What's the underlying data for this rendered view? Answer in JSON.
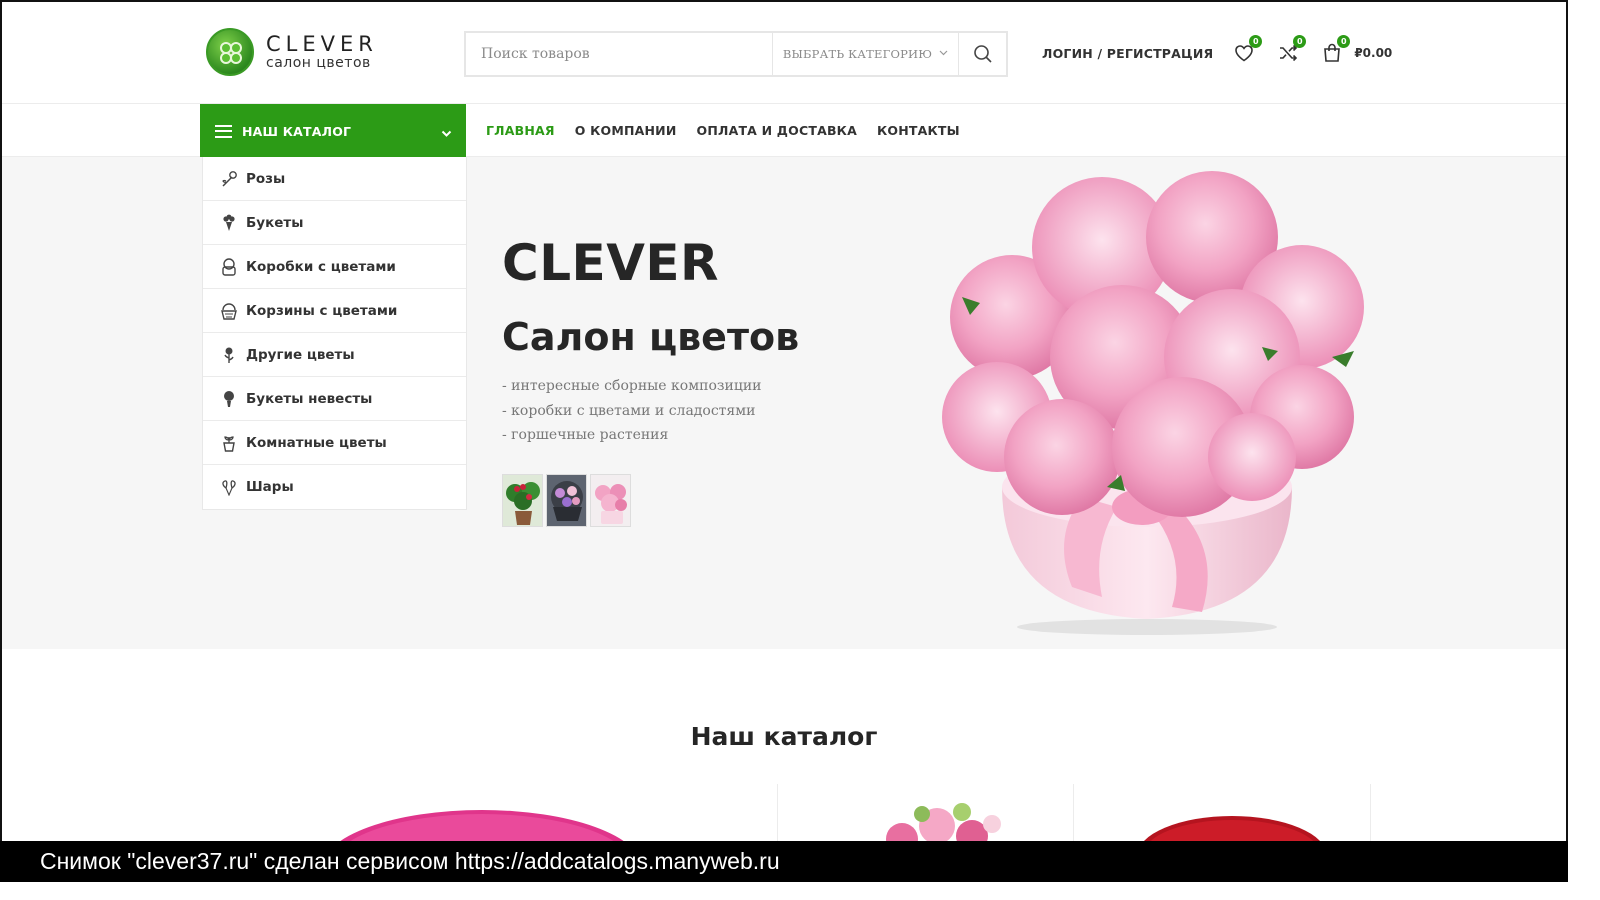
{
  "brand": {
    "title": "CLEVER",
    "subtitle": "салон цветов"
  },
  "search": {
    "placeholder": "Поиск товаров",
    "category": "ВЫБРАТЬ КАТЕГОРИЮ"
  },
  "header": {
    "login": "ЛОГИН / РЕГИСТРАЦИЯ",
    "wishlist_count": "0",
    "compare_count": "0",
    "cart_count": "0",
    "cart_total": "₽0.00"
  },
  "nav": {
    "catalog_label": "НАШ КАТАЛОГ",
    "items": [
      {
        "label": "ГЛАВНАЯ",
        "active": true
      },
      {
        "label": "О КОМПАНИИ",
        "active": false
      },
      {
        "label": "ОПЛАТА И ДОСТАВКА",
        "active": false
      },
      {
        "label": "КОНТАКТЫ",
        "active": false
      }
    ]
  },
  "sidebar": {
    "items": [
      {
        "label": "Розы",
        "icon": "rose-icon"
      },
      {
        "label": "Букеты",
        "icon": "bouquet-icon"
      },
      {
        "label": "Коробки с цветами",
        "icon": "flower-box-icon"
      },
      {
        "label": "Корзины с цветами",
        "icon": "flower-basket-icon"
      },
      {
        "label": "Другие цветы",
        "icon": "other-flowers-icon"
      },
      {
        "label": "Букеты невесты",
        "icon": "bridal-bouquet-icon"
      },
      {
        "label": "Комнатные цветы",
        "icon": "potted-plant-icon"
      },
      {
        "label": "Шары",
        "icon": "balloons-icon"
      }
    ]
  },
  "hero": {
    "title": "CLEVER",
    "subtitle": "Салон цветов",
    "bullets": [
      "- интересные сборные композиции",
      "- коробки с цветами и сладостями",
      "- горшечные растения"
    ]
  },
  "catalog": {
    "title": "Наш каталог"
  },
  "footer_bar": {
    "text": "Снимок \"clever37.ru\" сделан сервисом https://addcatalogs.manyweb.ru"
  },
  "colors": {
    "accent": "#2c9b16",
    "hero_bg": "#f6f6f6",
    "text": "#262626"
  }
}
